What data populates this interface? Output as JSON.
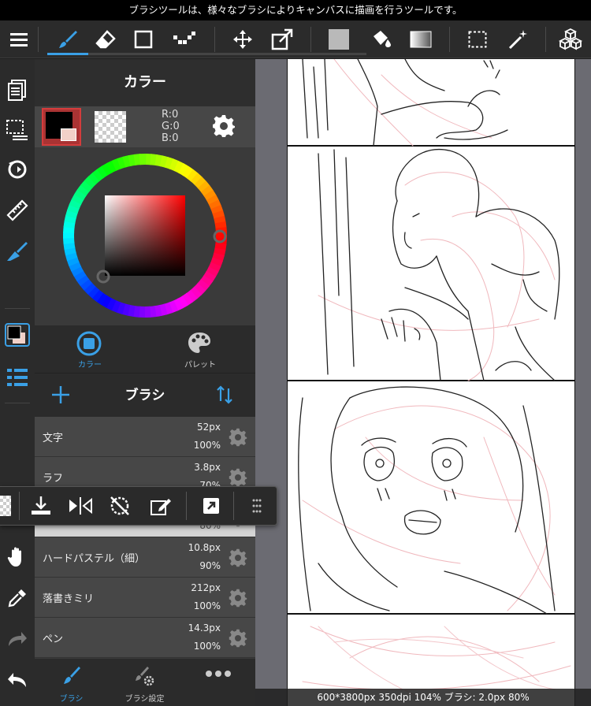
{
  "tip": "ブラシツールは、様々なブラシによりキャンバスに描画を行うツールです。",
  "toolbar": {
    "icons": [
      "menu-icon",
      "brush-icon",
      "eraser-icon",
      "rectangle-icon",
      "dot-line-icon",
      "move-icon",
      "transform-icon",
      "fill-color-icon",
      "bucket-icon",
      "gradient-icon",
      "selection-icon",
      "magic-wand-icon",
      "3d-cubes-icon"
    ]
  },
  "color_panel": {
    "title": "カラー",
    "r": "R:0",
    "g": "G:0",
    "b": "B:0",
    "main_color": "#000000",
    "sub_color": "#f2d1c8",
    "tab_color": "カラー",
    "tab_palette": "パレット"
  },
  "brush_panel": {
    "title": "ブラシ",
    "items": [
      {
        "name": "文字",
        "size": "52px",
        "opacity": "100%"
      },
      {
        "name": "ラフ",
        "size": "3.8px",
        "opacity": "70%"
      },
      {
        "name": "",
        "size": "",
        "opacity": "80%"
      },
      {
        "name": "ハードパステル（細）",
        "size": "10.8px",
        "opacity": "90%"
      },
      {
        "name": "落書きミリ",
        "size": "212px",
        "opacity": "100%"
      },
      {
        "name": "ペン",
        "size": "14.3px",
        "opacity": "100%"
      }
    ],
    "tab_brush": "ブラシ",
    "tab_settings": "ブラシ設定"
  },
  "status": "600*3800px 350dpi 104% ブラシ: 2.0px 80%",
  "colors": {
    "accent": "#3aa0e6",
    "panel": "#3a3a3a",
    "toolbar": "#2b2b2b"
  }
}
